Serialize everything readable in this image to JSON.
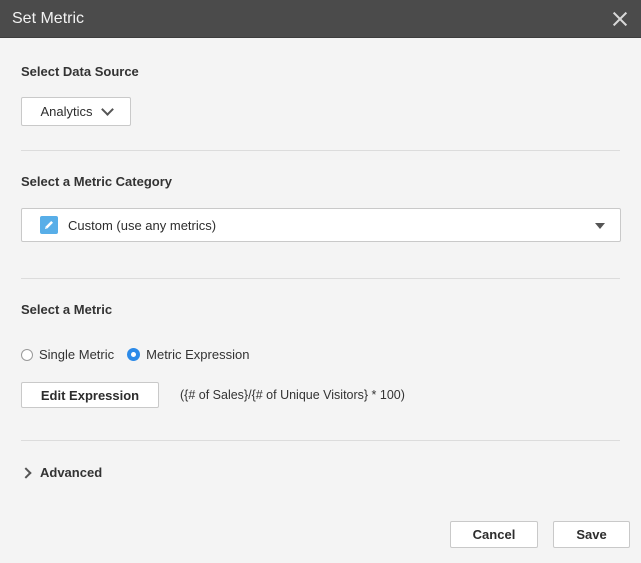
{
  "dialog": {
    "title": "Set Metric"
  },
  "data_source": {
    "heading": "Select Data Source",
    "selected": "Analytics"
  },
  "metric_category": {
    "heading": "Select a Metric Category",
    "selected": "Custom (use any metrics)"
  },
  "metric": {
    "heading": "Select a Metric",
    "options": [
      {
        "label": "Single Metric",
        "checked": false
      },
      {
        "label": "Metric Expression",
        "checked": true
      }
    ],
    "edit_label": "Edit Expression",
    "expression": "({# of Sales}/{# of Unique Visitors} * 100)"
  },
  "advanced": {
    "label": "Advanced"
  },
  "footer": {
    "cancel_label": "Cancel",
    "save_label": "Save"
  },
  "colors": {
    "titlebar": "#4b4b4b",
    "accent": "#2c8ae8",
    "pencil": "#58aee8"
  }
}
